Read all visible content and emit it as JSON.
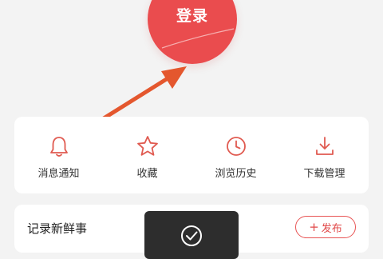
{
  "login": {
    "label": "登录"
  },
  "menu": [
    {
      "label": "消息通知",
      "icon": "bell-icon"
    },
    {
      "label": "收藏",
      "icon": "star-icon"
    },
    {
      "label": "浏览历史",
      "icon": "clock-icon"
    },
    {
      "label": "下载管理",
      "icon": "download-icon"
    }
  ],
  "feed": {
    "title": "记录新鲜事",
    "publish_label": "发布",
    "publish_icon": "plus-icon"
  },
  "toast": {
    "icon": "check-circle-icon"
  },
  "colors": {
    "accent": "#ea4c4e",
    "arrow": "#e4572e",
    "icon_red": "#e05a50"
  }
}
